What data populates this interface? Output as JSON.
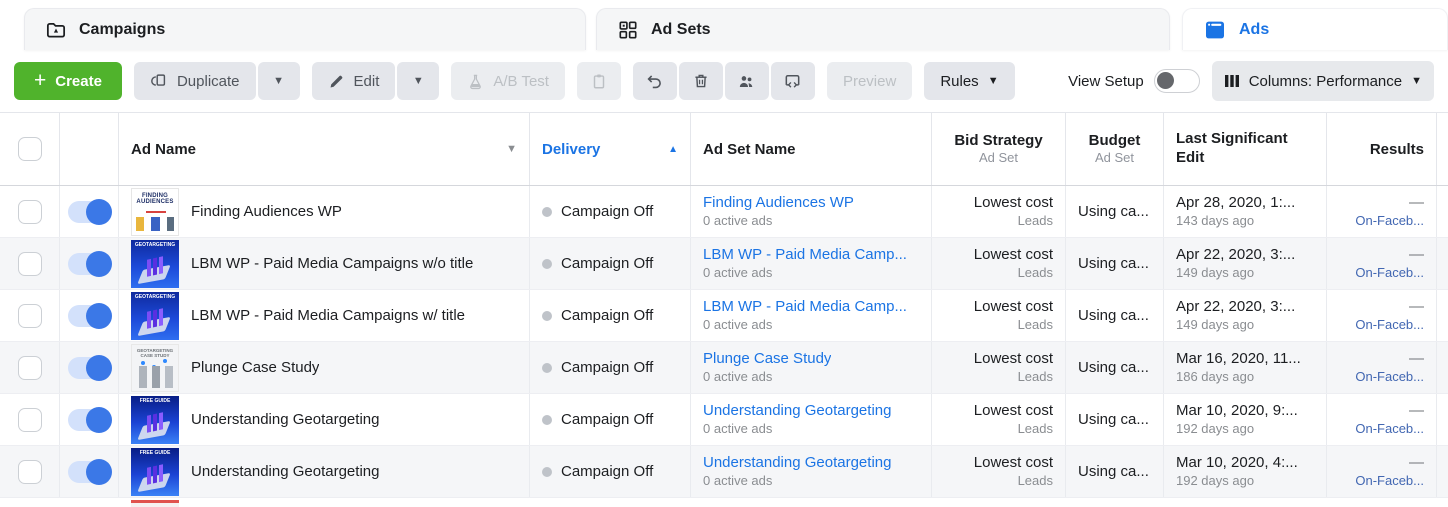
{
  "tabs": [
    {
      "label": "Campaigns"
    },
    {
      "label": "Ad Sets"
    },
    {
      "label": "Ads"
    }
  ],
  "toolbar": {
    "create": "Create",
    "duplicate": "Duplicate",
    "edit": "Edit",
    "ab_test": "A/B Test",
    "preview": "Preview",
    "rules": "Rules",
    "view_setup": "View Setup",
    "columns": "Columns: Performance"
  },
  "table": {
    "headers": {
      "ad_name": "Ad Name",
      "delivery": "Delivery",
      "ad_set_name": "Ad Set Name",
      "bid_strategy": "Bid Strategy",
      "bid_strategy_sub": "Ad Set",
      "budget": "Budget",
      "budget_sub": "Ad Set",
      "last_edit": "Last Significant Edit",
      "results": "Results"
    },
    "rows": [
      {
        "thumb": "finding-audiences",
        "thumb_caption": "FINDING AUDIENCES",
        "name": "Finding Audiences WP",
        "delivery": "Campaign Off",
        "ad_set": "Finding Audiences WP",
        "ad_set_sub": "0 active ads",
        "bid": "Lowest cost",
        "bid_sub": "Leads",
        "budget": "Using ca...",
        "edit": "Apr 28, 2020, 1:...",
        "edit_sub": "143 days ago",
        "result": "—",
        "result_sub": "On-Faceb..."
      },
      {
        "thumb": "geotargeting",
        "thumb_caption": "GEOTARGETING",
        "name": "LBM WP - Paid Media Campaigns w/o title",
        "delivery": "Campaign Off",
        "ad_set": "LBM WP - Paid Media Camp...",
        "ad_set_sub": "0 active ads",
        "bid": "Lowest cost",
        "bid_sub": "Leads",
        "budget": "Using ca...",
        "edit": "Apr 22, 2020, 3:...",
        "edit_sub": "149 days ago",
        "result": "—",
        "result_sub": "On-Faceb..."
      },
      {
        "thumb": "geotargeting",
        "thumb_caption": "GEOTARGETING",
        "name": "LBM WP - Paid Media Campaigns w/ title",
        "delivery": "Campaign Off",
        "ad_set": "LBM WP - Paid Media Camp...",
        "ad_set_sub": "0 active ads",
        "bid": "Lowest cost",
        "bid_sub": "Leads",
        "budget": "Using ca...",
        "edit": "Apr 22, 2020, 3:...",
        "edit_sub": "149 days ago",
        "result": "—",
        "result_sub": "On-Faceb..."
      },
      {
        "thumb": "case-study",
        "thumb_caption": "GEOTARGETING CASE STUDY",
        "name": "Plunge Case Study",
        "delivery": "Campaign Off",
        "ad_set": "Plunge Case Study",
        "ad_set_sub": "0 active ads",
        "bid": "Lowest cost",
        "bid_sub": "Leads",
        "budget": "Using ca...",
        "edit": "Mar 16, 2020, 11...",
        "edit_sub": "186 days ago",
        "result": "—",
        "result_sub": "On-Faceb..."
      },
      {
        "thumb": "free-guide",
        "thumb_caption": "FREE GUIDE",
        "name": "Understanding Geotargeting",
        "delivery": "Campaign Off",
        "ad_set": "Understanding Geotargeting",
        "ad_set_sub": "0 active ads",
        "bid": "Lowest cost",
        "bid_sub": "Leads",
        "budget": "Using ca...",
        "edit": "Mar 10, 2020, 9:...",
        "edit_sub": "192 days ago",
        "result": "—",
        "result_sub": "On-Faceb..."
      },
      {
        "thumb": "free-guide",
        "thumb_caption": "FREE GUIDE",
        "name": "Understanding Geotargeting",
        "delivery": "Campaign Off",
        "ad_set": "Understanding Geotargeting",
        "ad_set_sub": "0 active ads",
        "bid": "Lowest cost",
        "bid_sub": "Leads",
        "budget": "Using ca...",
        "edit": "Mar 10, 2020, 4:...",
        "edit_sub": "192 days ago",
        "result": "—",
        "result_sub": "On-Faceb..."
      }
    ]
  },
  "colors": {
    "accent_blue": "#1b74e4",
    "results_blue": "#4267b2",
    "create_green": "#50b32c",
    "toggle_on_blue": "#3b78e7"
  }
}
